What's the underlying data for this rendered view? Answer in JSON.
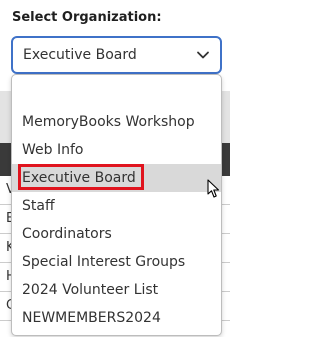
{
  "heading": "Select Organization:",
  "select": {
    "value": "Executive Board"
  },
  "options": [
    {
      "label": ""
    },
    {
      "label": "MemoryBooks Workshop"
    },
    {
      "label": "Web Info"
    },
    {
      "label": "Executive Board",
      "hovered": true
    },
    {
      "label": "Staff"
    },
    {
      "label": "Coordinators"
    },
    {
      "label": "Special Interest Groups"
    },
    {
      "label": "2024 Volunteer List"
    },
    {
      "label": "NEWMEMBERS2024"
    }
  ],
  "background_rows": [
    {
      "left": "V"
    },
    {
      "left": "E"
    },
    {
      "left": "K"
    },
    {
      "left": "H"
    },
    {
      "left": "C"
    }
  ],
  "colors": {
    "accent": "#3f72c8",
    "highlight": "#e0141e",
    "hover": "#d9d9d9",
    "band": "#3a3a3a"
  }
}
